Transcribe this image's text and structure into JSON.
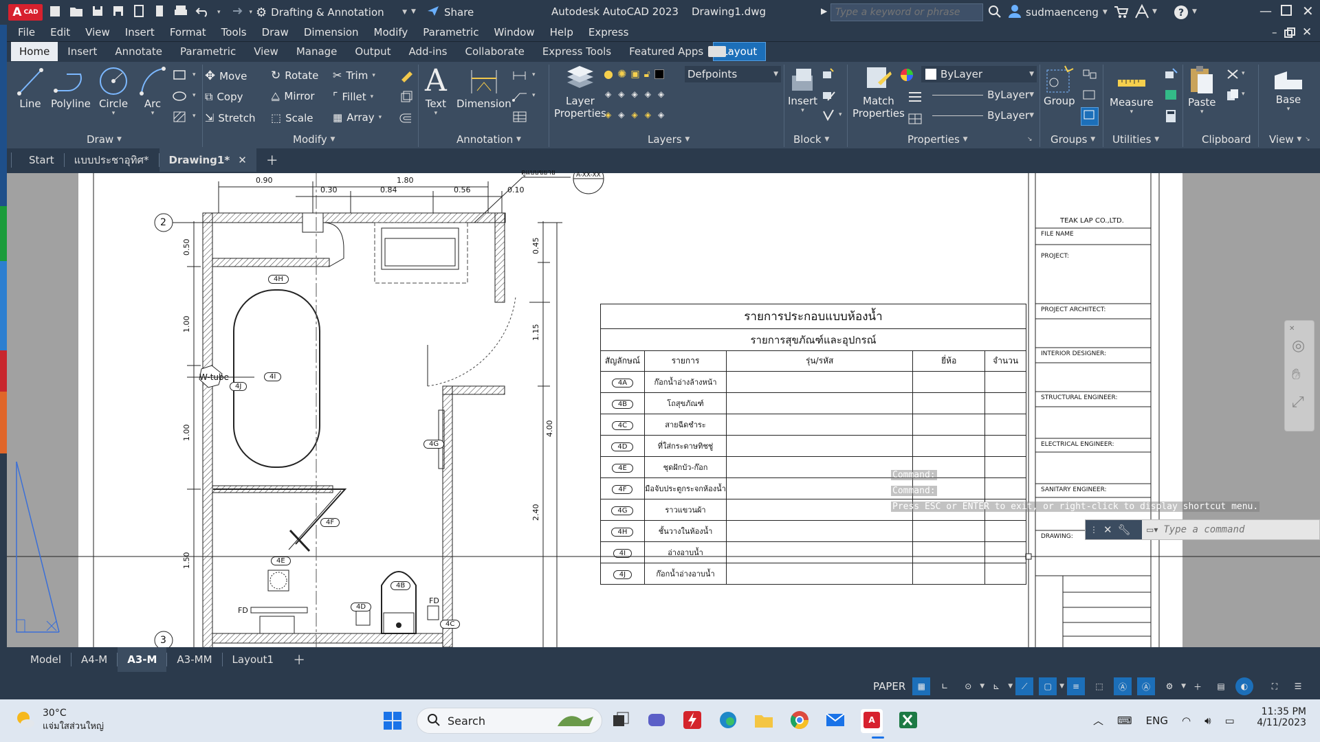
{
  "titlebar": {
    "app_badge": "A",
    "app_badge_sub": "CAD",
    "workspace": "Drafting & Annotation",
    "share": "Share",
    "title": "Autodesk AutoCAD 2023",
    "drawing": "Drawing1.dwg",
    "search_placeholder": "Type a keyword or phrase",
    "user": "sudmaenceng",
    "accent": "#d7212e"
  },
  "menu": [
    "File",
    "Edit",
    "View",
    "Insert",
    "Format",
    "Tools",
    "Draw",
    "Dimension",
    "Modify",
    "Parametric",
    "Window",
    "Help",
    "Express"
  ],
  "ribbon_tabs": [
    "Home",
    "Insert",
    "Annotate",
    "Parametric",
    "View",
    "Manage",
    "Output",
    "Add-ins",
    "Collaborate",
    "Express Tools",
    "Featured Apps",
    "Layout"
  ],
  "ribbon": {
    "draw": {
      "title": "Draw",
      "line": "Line",
      "polyline": "Polyline",
      "circle": "Circle",
      "arc": "Arc"
    },
    "modify": {
      "title": "Modify",
      "move": "Move",
      "rotate": "Rotate",
      "trim": "Trim",
      "copy": "Copy",
      "mirror": "Mirror",
      "fillet": "Fillet",
      "stretch": "Stretch",
      "scale": "Scale",
      "array": "Array"
    },
    "annotation": {
      "title": "Annotation",
      "text": "Text",
      "dimension": "Dimension"
    },
    "layers": {
      "title": "Layers",
      "layer_properties_1": "Layer",
      "layer_properties_2": "Properties",
      "current_layer": "Defpoints"
    },
    "block": {
      "title": "Block",
      "insert": "Insert"
    },
    "properties": {
      "title": "Properties",
      "match_1": "Match",
      "match_2": "Properties",
      "color": "ByLayer",
      "linetype": "ByLayer",
      "lineweight": "ByLayer"
    },
    "groups": {
      "title": "Groups",
      "group": "Group"
    },
    "utilities": {
      "title": "Utilities",
      "measure": "Measure"
    },
    "clipboard": {
      "title": "Clipboard",
      "paste": "Paste"
    },
    "view": {
      "title": "View",
      "base": "Base"
    }
  },
  "doc_tabs": [
    "Start",
    "แบบประชาอุทิศ*",
    "Drawing1*"
  ],
  "layout_tabs": [
    "Model",
    "A4-M",
    "A3-M",
    "A3-MM",
    "Layout1"
  ],
  "drawing": {
    "dims_top": [
      "0.90",
      "1.80",
      "0.30",
      "0.84",
      "0.56",
      "0.10"
    ],
    "dims_left": [
      "0.50",
      "1.00",
      "1.00",
      "1.50"
    ],
    "dims_right": [
      "0.45",
      "1.15",
      "2.40",
      "4.00"
    ],
    "grid_2": "2",
    "grid_3": "3",
    "detail_label": "ดูแบบขยาย",
    "detail_ref": "A-XX-XX",
    "tags": [
      "4H",
      "4I",
      "4J",
      "4G",
      "4F",
      "4E",
      "4B",
      "4D",
      "4C"
    ],
    "fd1": "FD",
    "fd2": "FD",
    "wtube": "W-tube"
  },
  "schedule": {
    "title": "รายการประกอบแบบห้องน้ำ",
    "subtitle": "รายการสุขภัณฑ์และอุปกรณ์",
    "headers": [
      "สัญลักษณ์",
      "รายการ",
      "รุ่น/รหัส",
      "ยี่ห้อ",
      "จำนวน"
    ],
    "rows": [
      {
        "tag": "4A",
        "item": "ก๊อกน้ำอ่างล้างหน้า"
      },
      {
        "tag": "4B",
        "item": "โถสุขภัณฑ์"
      },
      {
        "tag": "4C",
        "item": "สายฉีดชำระ"
      },
      {
        "tag": "4D",
        "item": "ที่ใส่กระดาษทิชชู่"
      },
      {
        "tag": "4E",
        "item": "ชุดฝักบัว-ก๊อก"
      },
      {
        "tag": "4F",
        "item": "มือจับประตูกระจกห้องน้ำ"
      },
      {
        "tag": "4G",
        "item": "ราวแขวนผ้า"
      },
      {
        "tag": "4H",
        "item": "ชั้นวางในห้องน้ำ"
      },
      {
        "tag": "4I",
        "item": "อ่างอาบน้ำ"
      },
      {
        "tag": "4J",
        "item": "ก๊อกน้ำอ่างอาบน้ำ"
      }
    ]
  },
  "titleblock": {
    "company": "TEAK LAP CO.,LTD.",
    "fields": [
      "FILE NAME",
      "PROJECT:",
      "PROJECT ARCHITECT:",
      "INTERIOR DESIGNER:",
      "STRUCTURAL ENGINEER:",
      "ELECTRICAL ENGINEER:",
      "SANITARY ENGINEER:",
      "DRAWING:"
    ]
  },
  "command": {
    "history": [
      "Command:",
      "Command:",
      "Press ESC or ENTER to exit, or right-click to display shortcut menu."
    ],
    "placeholder": "Type a command"
  },
  "status": {
    "space": "PAPER"
  },
  "taskbar": {
    "weather_temp": "30°C",
    "weather_desc": "แจ่มใสส่วนใหญ่",
    "search": "Search",
    "lang": "ENG",
    "time": "11:35 PM",
    "date": "4/11/2023"
  }
}
